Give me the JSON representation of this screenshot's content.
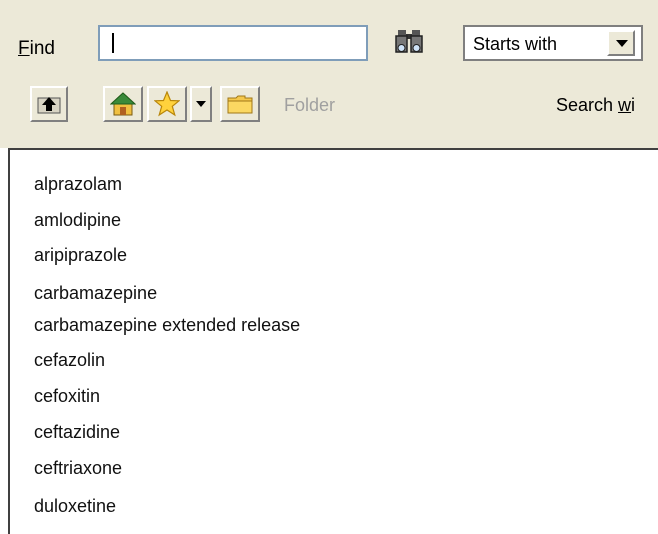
{
  "find": {
    "label_hotkey": "F",
    "label_rest": "ind",
    "value": "",
    "match_mode": "Starts with"
  },
  "toolbar": {
    "folder_label": "Folder",
    "search_prefix": "Search ",
    "search_hotkey": "w",
    "search_rest": "i"
  },
  "drugs": [
    "alprazolam",
    "amlodipine",
    "aripiprazole",
    "carbamazepine",
    "carbamazepine extended release",
    "cefazolin",
    "cefoxitin",
    "ceftazidine",
    "ceftriaxone",
    "duloxetine"
  ],
  "icons": [
    "binoculars-icon",
    "chevron-down-icon",
    "folder-up-icon",
    "home-icon",
    "star-icon",
    "folder-icon"
  ]
}
